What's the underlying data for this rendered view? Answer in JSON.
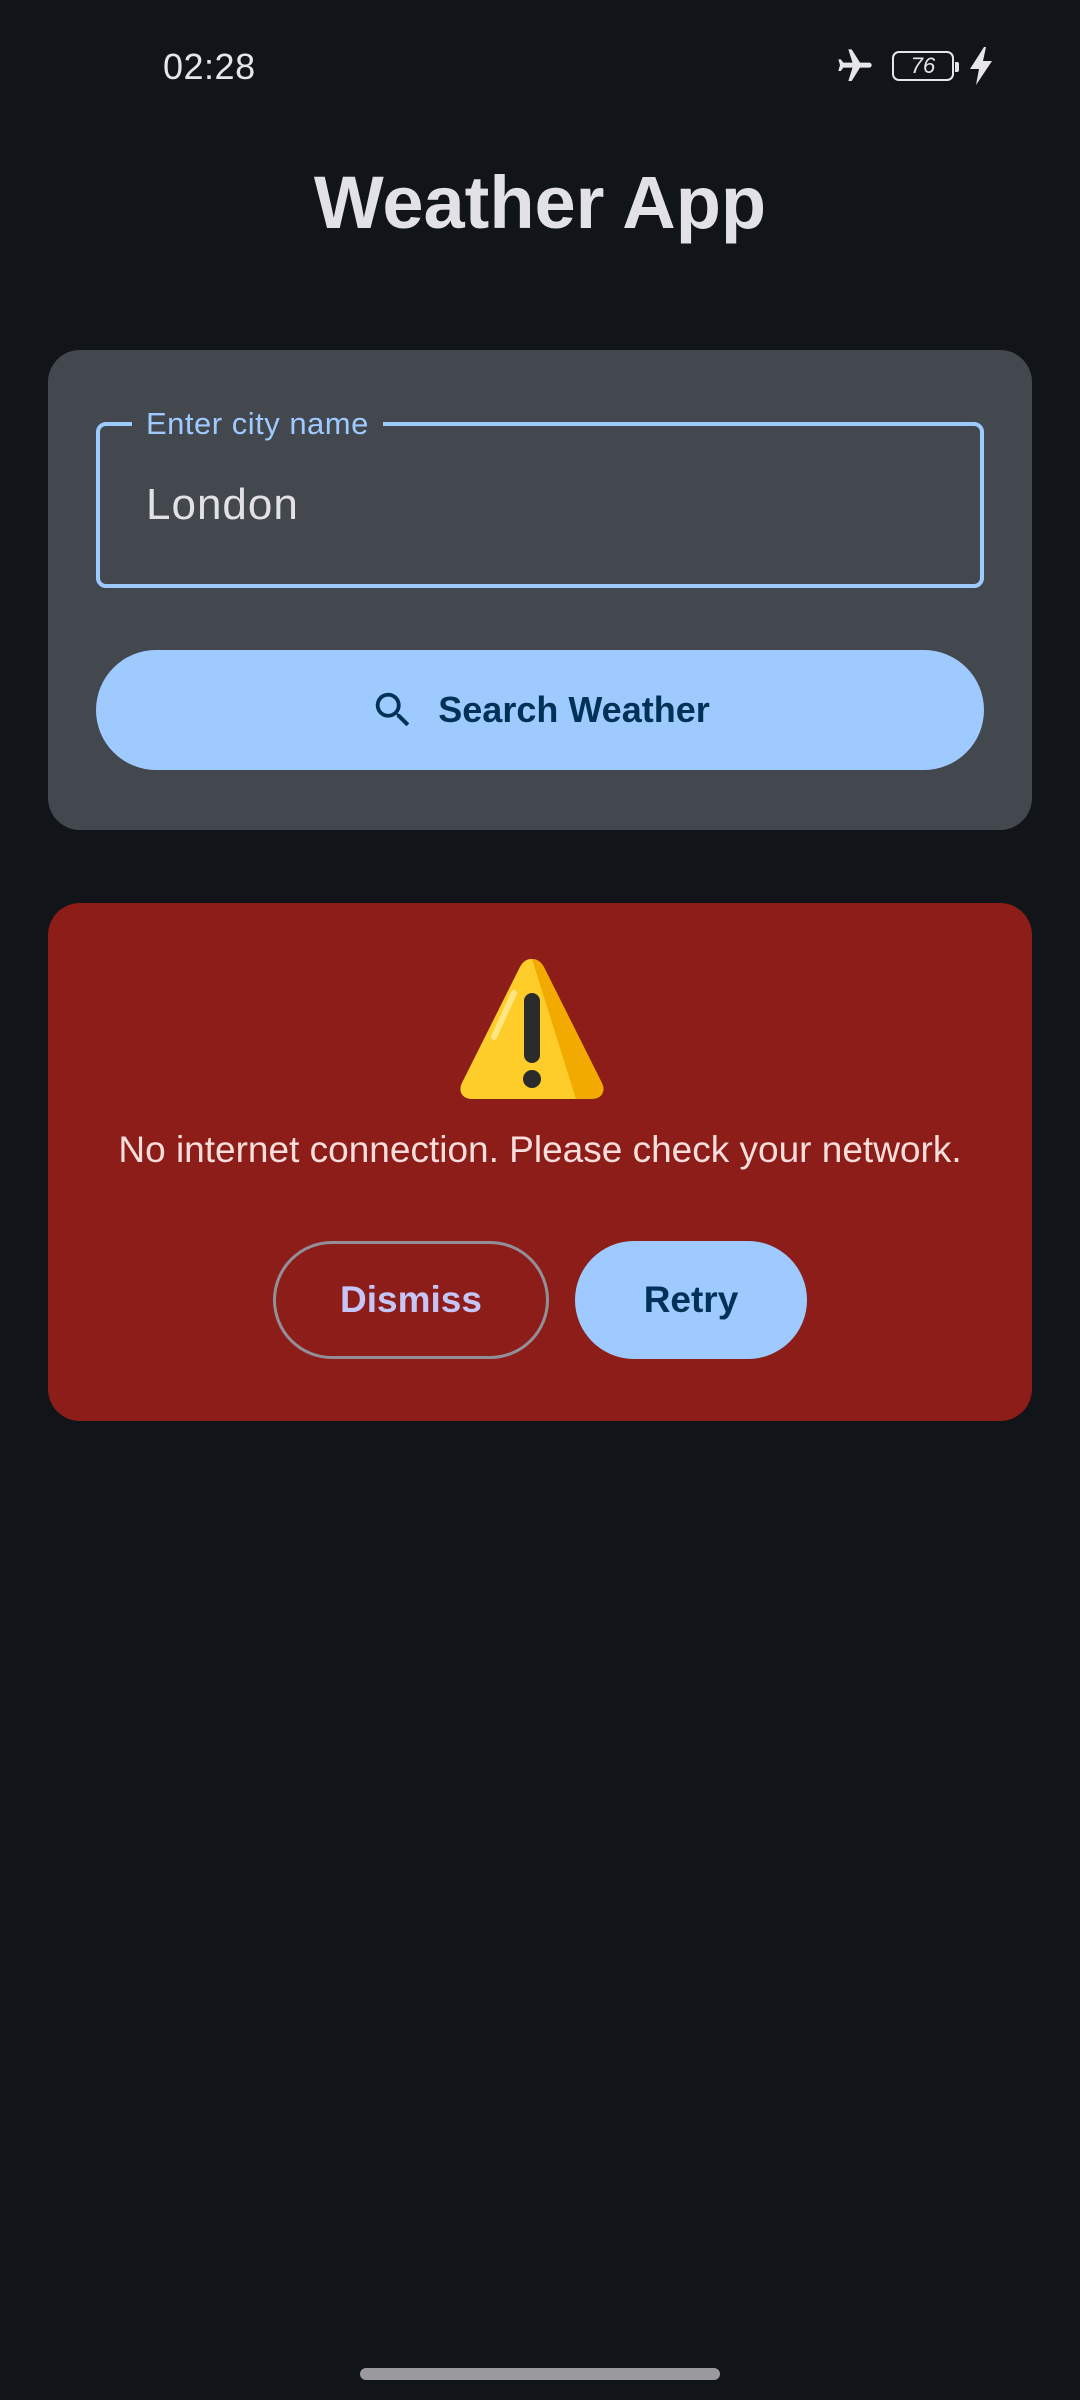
{
  "status_bar": {
    "time": "02:28",
    "battery_level": "76",
    "icons": [
      "airplane-mode-icon",
      "battery-icon",
      "charging-icon"
    ]
  },
  "header": {
    "title": "Weather App"
  },
  "search": {
    "field_label": "Enter city name",
    "field_value": "London",
    "button_label": "Search Weather",
    "button_icon": "search-icon"
  },
  "error": {
    "icon": "warning-icon",
    "message": "No internet connection. Please check your network.",
    "dismiss_label": "Dismiss",
    "retry_label": "Retry"
  },
  "colors": {
    "background": "#111418",
    "card": "#43474e",
    "accent": "#9ecaff",
    "on_accent": "#003258",
    "error_container": "#8c1d18",
    "warning": "#ffc629"
  }
}
